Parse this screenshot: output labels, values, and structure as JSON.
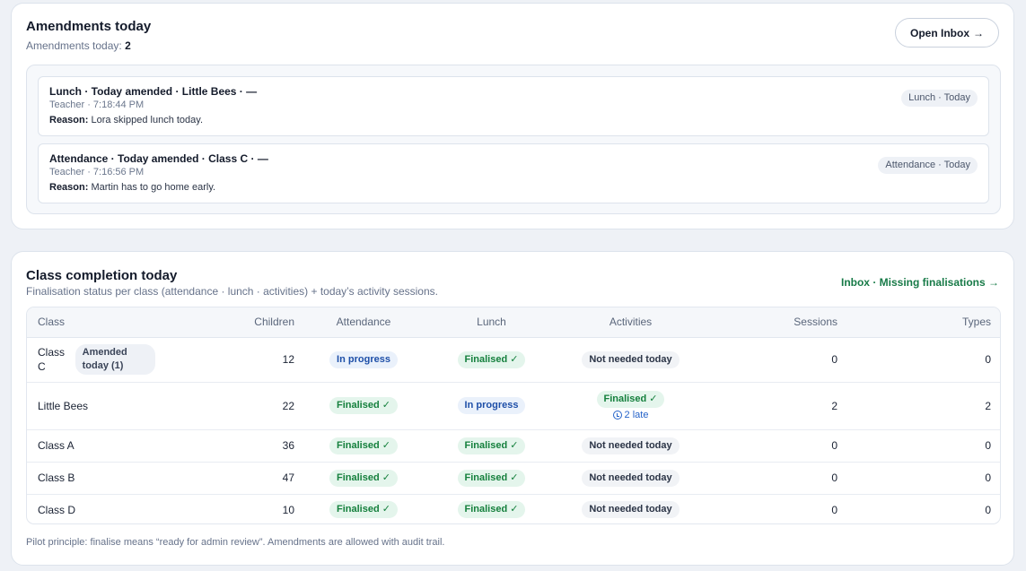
{
  "amendments": {
    "title": "Amendments today",
    "subtitle_label": "Amendments today:",
    "subtitle_count": "2",
    "open_inbox_label": "Open Inbox",
    "open_inbox_arrow": "→",
    "items": [
      {
        "title": "Lunch · Today amended · Little Bees · —",
        "meta": "Teacher · 7:18:44 PM",
        "reason_label": "Reason:",
        "reason": "Lora skipped lunch today.",
        "tag": "Lunch · Today"
      },
      {
        "title": "Attendance · Today amended · Class C · —",
        "meta": "Teacher · 7:16:56 PM",
        "reason_label": "Reason:",
        "reason": "Martin has to go home early.",
        "tag": "Attendance · Today"
      }
    ]
  },
  "completion": {
    "title": "Class completion today",
    "subtitle": "Finalisation status per class (attendance · lunch · activities) + today’s activity sessions.",
    "inbox_link": "Inbox · Missing finalisations →",
    "headers": {
      "class": "Class",
      "children": "Children",
      "attendance": "Attendance",
      "lunch": "Lunch",
      "activities": "Activities",
      "sessions": "Sessions",
      "types": "Types"
    },
    "rows": [
      {
        "class": "Class C",
        "badge": "Amended today (1)",
        "children": "12",
        "attendance": "In progress",
        "lunch": "Finalised ✓",
        "activities": "Not needed today",
        "late": "",
        "sessions": "0",
        "types": "0"
      },
      {
        "class": "Little Bees",
        "badge": "",
        "children": "22",
        "attendance": "Finalised ✓",
        "lunch": "In progress",
        "activities": "Finalised ✓",
        "late": "2 late",
        "sessions": "2",
        "types": "2"
      },
      {
        "class": "Class A",
        "badge": "",
        "children": "36",
        "attendance": "Finalised ✓",
        "lunch": "Finalised ✓",
        "activities": "Not needed today",
        "late": "",
        "sessions": "0",
        "types": "0"
      },
      {
        "class": "Class B",
        "badge": "",
        "children": "47",
        "attendance": "Finalised ✓",
        "lunch": "Finalised ✓",
        "activities": "Not needed today",
        "late": "",
        "sessions": "0",
        "types": "0"
      },
      {
        "class": "Class D",
        "badge": "",
        "children": "10",
        "attendance": "Finalised ✓",
        "lunch": "Finalised ✓",
        "activities": "Not needed today",
        "late": "",
        "sessions": "0",
        "types": "0"
      }
    ],
    "footnote": "Pilot principle: finalise means “ready for admin review”. Amendments are allowed with audit trail."
  },
  "colors": {
    "finalised": "#15803d",
    "in_progress": "#1e4fa8",
    "link_green": "#177a47",
    "late_blue": "#2563c9"
  },
  "icons": {
    "late": "clock-icon"
  }
}
